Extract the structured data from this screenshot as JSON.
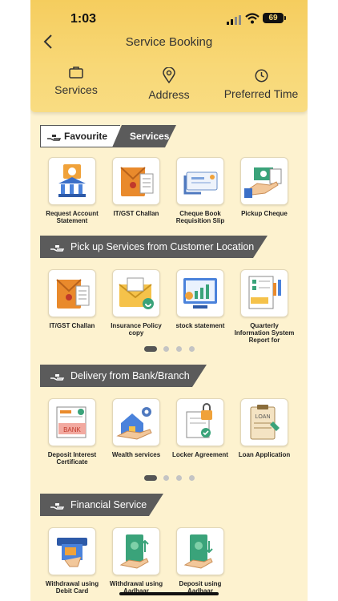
{
  "status_bar": {
    "time": "1:03",
    "battery": "69"
  },
  "header": {
    "title": "Service Booking"
  },
  "tabs": [
    {
      "label": "Services",
      "icon": "briefcase-icon"
    },
    {
      "label": "Address",
      "icon": "location-pin-icon"
    },
    {
      "label": "Preferred Time",
      "icon": "clock-icon"
    }
  ],
  "favourite": {
    "label_left": "Favourite",
    "label_right": "Services",
    "items": [
      {
        "label": "Request Account Statement",
        "icon": "bank-statement-icon"
      },
      {
        "label": "IT/GST Challan",
        "icon": "challan-envelope-icon"
      },
      {
        "label": "Cheque Book Requisition Slip",
        "icon": "cheque-book-icon"
      },
      {
        "label": "Pickup Cheque",
        "icon": "hand-cheque-icon"
      }
    ]
  },
  "pickup": {
    "title": "Pick up Services from Customer Location",
    "items": [
      {
        "label": "IT/GST Challan",
        "icon": "challan-envelope-icon"
      },
      {
        "label": "Insurance Policy copy",
        "icon": "insurance-envelope-icon"
      },
      {
        "label": "stock statement",
        "icon": "stock-report-icon"
      },
      {
        "label": "Quarterly Information System Report for",
        "icon": "audit-report-icon"
      }
    ],
    "pages": 4,
    "active_page": 1
  },
  "delivery": {
    "title": "Delivery from Bank/Branch",
    "items": [
      {
        "label": "Deposit Interest Certificate",
        "icon": "certificate-icon"
      },
      {
        "label": "Wealth services",
        "icon": "wealth-house-icon"
      },
      {
        "label": "Locker Agreement",
        "icon": "locker-agreement-icon"
      },
      {
        "label": "Loan Application",
        "icon": "loan-clipboard-icon"
      }
    ],
    "pages": 4,
    "active_page": 1
  },
  "financial": {
    "title": "Financial Service",
    "items": [
      {
        "label": "Withdrawal using Debit Card",
        "icon": "atm-card-icon"
      },
      {
        "label": "Withdrawal using Aadhaar",
        "icon": "cash-up-icon"
      },
      {
        "label": "Deposit using Aadhaar",
        "icon": "cash-down-icon"
      }
    ]
  },
  "colors": {
    "header": "#f8d877",
    "page_bg": "#fdf2cf",
    "banner": "#5b5b5b",
    "accent_orange": "#e98a2c",
    "accent_green": "#3aa37a"
  }
}
